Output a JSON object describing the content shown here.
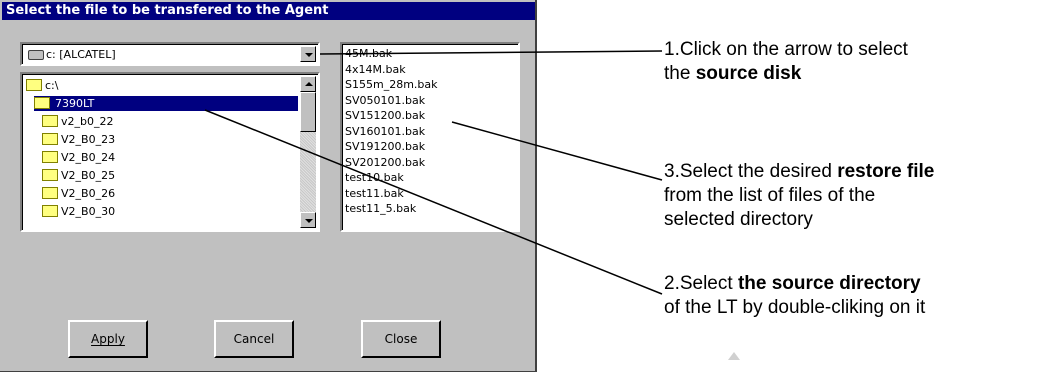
{
  "dialog": {
    "title": "Select the file to be transfered to the Agent",
    "drive_combo": {
      "value": "c: [ALCATEL]",
      "icon": "drive-icon"
    },
    "tree": [
      {
        "label": "c:\\",
        "level": 0,
        "selected": false
      },
      {
        "label": "7390LT",
        "level": 1,
        "selected": true
      },
      {
        "label": "v2_b0_22",
        "level": 2,
        "selected": false
      },
      {
        "label": "V2_B0_23",
        "level": 2,
        "selected": false
      },
      {
        "label": "V2_B0_24",
        "level": 2,
        "selected": false
      },
      {
        "label": "V2_B0_25",
        "level": 2,
        "selected": false
      },
      {
        "label": "V2_B0_26",
        "level": 2,
        "selected": false
      },
      {
        "label": "V2_B0_30",
        "level": 2,
        "selected": false
      }
    ],
    "files": [
      "45M.bak",
      "4x14M.bak",
      "S155m_28m.bak",
      "SV050101.bak",
      "SV151200.bak",
      "SV160101.bak",
      "SV191200.bak",
      "SV201200.bak",
      "test10.bak",
      "test11.bak",
      "test11_5.bak"
    ],
    "buttons": {
      "apply": "Apply",
      "cancel": "Cancel",
      "close": "Close"
    }
  },
  "annotations": {
    "a1_line1": "1.Click on the arrow to select",
    "a1_pre": "the ",
    "a1_bold": "source disk",
    "a3_pre": "3.Select the desired ",
    "a3_bold": "restore file",
    "a3_line2": "from the list of files of the",
    "a3_line3": "selected directory",
    "a2_pre": "2.Select ",
    "a2_bold": "the source directory",
    "a2_line2": "of the LT by double-cliking on it"
  }
}
